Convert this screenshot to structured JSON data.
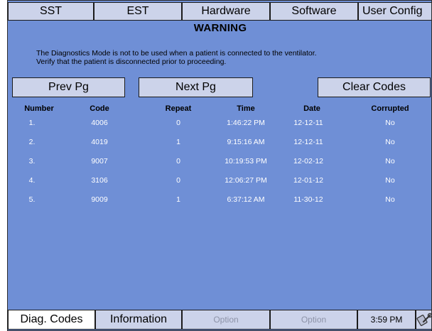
{
  "tabs": [
    "SST",
    "EST",
    "Hardware",
    "Software",
    "User Config"
  ],
  "warning": {
    "title": "WARNING",
    "line1": "The Diagnostics Mode is not to be used when a patient is connected to the ventilator.",
    "line2": "Verify that the patient is disconnected prior to proceeding."
  },
  "buttons": {
    "prev": "Prev Pg",
    "next": "Next Pg",
    "clear": "Clear Codes"
  },
  "table": {
    "headers": [
      "Number",
      "Code",
      "Repeat",
      "Time",
      "Date",
      "Corrupted"
    ],
    "rows": [
      {
        "number": "1.",
        "code": "4006",
        "repeat": "0",
        "time": "1:46:22 PM",
        "date": "12-12-11",
        "corrupted": "No"
      },
      {
        "number": "2.",
        "code": "4019",
        "repeat": "1",
        "time": "9:15:16 AM",
        "date": "12-12-11",
        "corrupted": "No"
      },
      {
        "number": "3.",
        "code": "9007",
        "repeat": "0",
        "time": "10:19:53 PM",
        "date": "12-02-12",
        "corrupted": "No"
      },
      {
        "number": "4.",
        "code": "3106",
        "repeat": "0",
        "time": "12:06:27 PM",
        "date": "12-01-12",
        "corrupted": "No"
      },
      {
        "number": "5.",
        "code": "9009",
        "repeat": "1",
        "time": "6:37:12 AM",
        "date": "11-30-12",
        "corrupted": "No"
      }
    ]
  },
  "bottom": {
    "diag": "Diag. Codes",
    "info": "Information",
    "option1": "Option",
    "option2": "Option",
    "clock": "3:59 PM"
  },
  "colors": {
    "screen_bg": "#6f8fd6",
    "button_bg": "#ccd3ea",
    "active_tab": "#ffffff",
    "row_text": "#ffffff"
  }
}
